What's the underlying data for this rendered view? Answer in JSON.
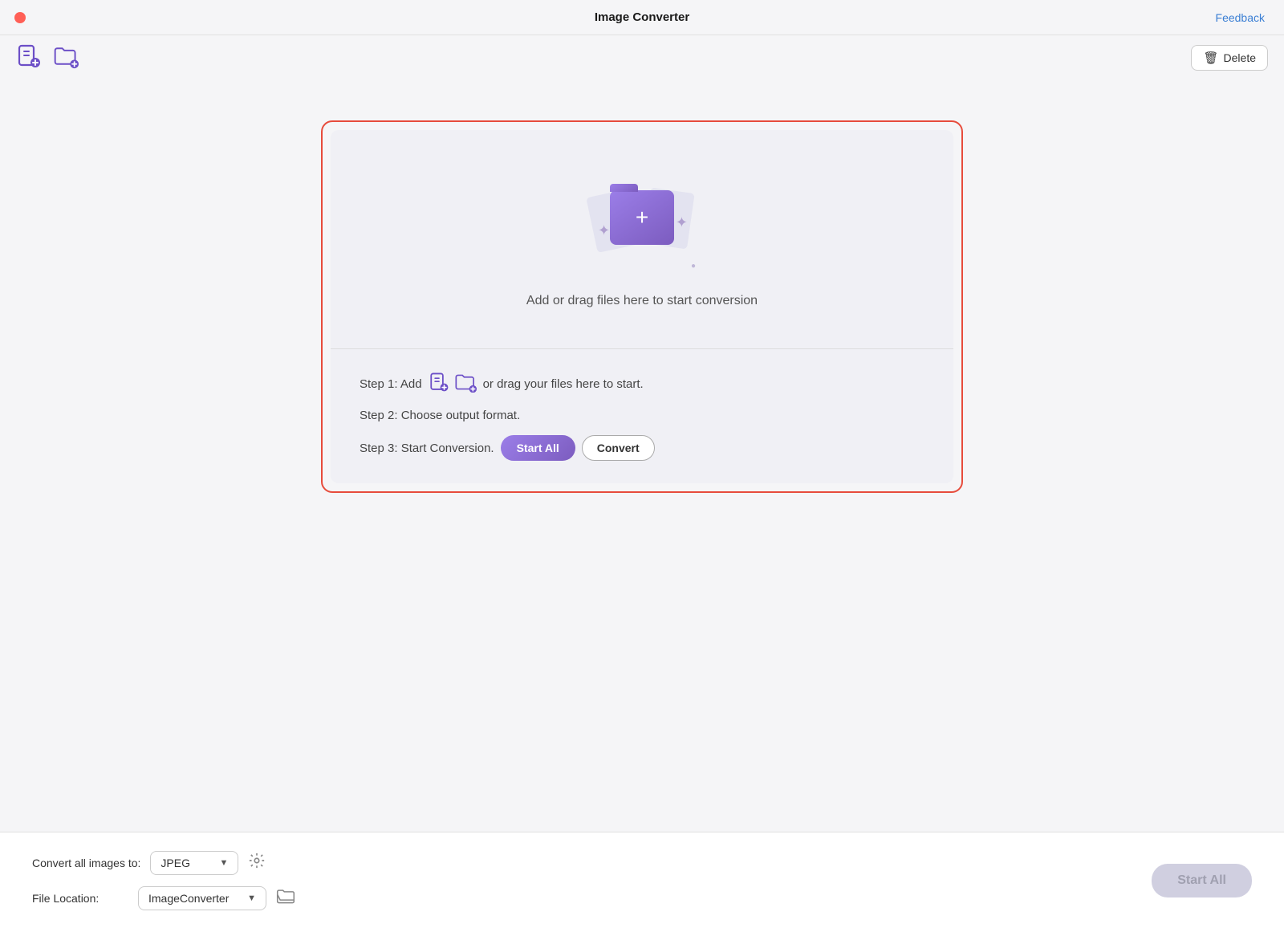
{
  "titleBar": {
    "title": "Image Converter",
    "feedbackLabel": "Feedback"
  },
  "toolbar": {
    "deleteLabel": "Delete",
    "addFileTooltip": "Add File",
    "addFolderTooltip": "Add Folder"
  },
  "dropZone": {
    "uploadText": "Add or drag files here to start conversion",
    "step1Text": "Step 1: Add",
    "step1Suffix": "or drag your files here to start.",
    "step2Text": "Step 2: Choose output format.",
    "step3Text": "Step 3: Start Conversion.",
    "startAllLabel": "Start  All",
    "convertLabel": "Convert"
  },
  "bottomBar": {
    "convertAllLabel": "Convert all images to:",
    "formatValue": "JPEG",
    "fileLocationLabel": "File Location:",
    "locationValue": "ImageConverter",
    "startAllLabel": "Start  All"
  }
}
